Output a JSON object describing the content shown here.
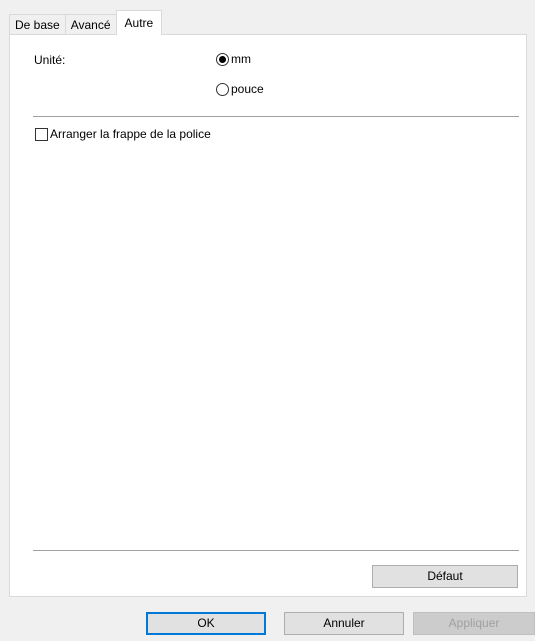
{
  "tabs": [
    {
      "label": "De base",
      "active": false
    },
    {
      "label": "Avancé",
      "active": false
    },
    {
      "label": "Autre",
      "active": true
    }
  ],
  "unit": {
    "label": "Unité:",
    "options": [
      {
        "label": "mm",
        "checked": true
      },
      {
        "label": "pouce",
        "checked": false
      }
    ]
  },
  "font_option": {
    "label": "Arranger la frappe de la police",
    "checked": false
  },
  "buttons": {
    "default_label": "Défaut",
    "ok_label": "OK",
    "cancel_label": "Annuler",
    "apply_label": "Appliquer",
    "apply_enabled": false
  },
  "colors": {
    "focus_border": "#0078d7",
    "disabled_text": "#a0a0a0"
  }
}
